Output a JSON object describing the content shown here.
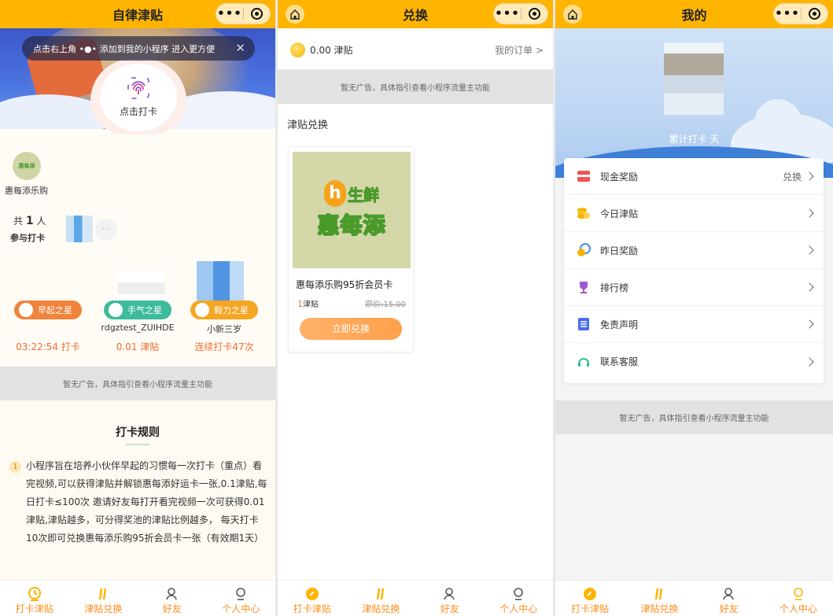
{
  "screen1": {
    "nav_title": "自律津贴",
    "toast": "点击右上角 •●• 添加到我的小程序 进入更方便",
    "punch_label": "点击打卡",
    "sponsor_name": "惠每添乐购",
    "sponsor_logo_text": "惠每添",
    "count_prefix": "共",
    "count_value": "1",
    "count_suffix": "人",
    "count_sub": "参与打卡",
    "more_avatar": "···",
    "stars": [
      {
        "label": "早起之星",
        "user": "",
        "value": "03:22:54 打卡",
        "color": "#f0843c"
      },
      {
        "label": "手气之星",
        "user": "rdgztest_ZUIHDE",
        "value": "0.01 津贴",
        "color": "#3dbb9a"
      },
      {
        "label": "毅力之星",
        "user": "小新三岁",
        "value": "连续打卡47次",
        "color": "#f5a623"
      }
    ],
    "ad_text": "暂无广告，具体指引查看小程序流量主功能",
    "rules_title": "打卡规则",
    "rule_num": "1",
    "rule_text": "小程序旨在培养小伙伴早起的习惯每一次打卡（重点）看完视频,可以获得津贴并解锁惠每添好运卡一张,0.1津贴,每日打卡≤100次 邀请好友每打开看完视频一次可获得0.01津贴,津贴越多，可分得奖池的津贴比例越多， 每天打卡10次即可兑换惠每添乐购95折会员卡一张（有效期1天）"
  },
  "screen2": {
    "nav_title": "兑换",
    "balance": "0.00 津贴",
    "orders_link": "我的订单",
    "ad_text": "暂无广告，具体指引查看小程序流量主功能",
    "section_title": "津贴兑换",
    "product": {
      "logo_h": "h",
      "logo_fresh": "生鲜",
      "logo_main": "惠每添",
      "name": "惠每添乐购95折会员卡",
      "price_value": "1",
      "price_unit": "津贴",
      "original": "原价:15.00",
      "button": "立即兑换"
    }
  },
  "screen3": {
    "nav_title": "我的",
    "profile_text": "累计打卡      天",
    "menu": [
      {
        "label": "现金奖励",
        "right": "兑换",
        "icon": "wallet-icon",
        "color": "#f05454"
      },
      {
        "label": "今日津贴",
        "right": "",
        "icon": "coins-icon",
        "color": "#f5b400"
      },
      {
        "label": "昨日奖励",
        "right": "",
        "icon": "coin-clock-icon",
        "color": "#4a8cf0"
      },
      {
        "label": "排行榜",
        "right": "",
        "icon": "trophy-icon",
        "color": "#9b59d0"
      },
      {
        "label": "免责声明",
        "right": "",
        "icon": "document-icon",
        "color": "#4a6cf0"
      },
      {
        "label": "联系客服",
        "right": "",
        "icon": "headset-icon",
        "color": "#2fbf8f"
      }
    ],
    "ad_text": "暂无广告，具体指引查看小程序流量主功能"
  },
  "tabs": [
    {
      "label": "打卡津贴",
      "icon": "checkin-icon"
    },
    {
      "label": "津贴兑换",
      "icon": "exchange-icon"
    },
    {
      "label": "好友",
      "icon": "friends-icon"
    },
    {
      "label": "个人中心",
      "icon": "profile-icon"
    }
  ],
  "colors": {
    "accent": "#ffb400",
    "highlight": "#ff8c1a"
  }
}
